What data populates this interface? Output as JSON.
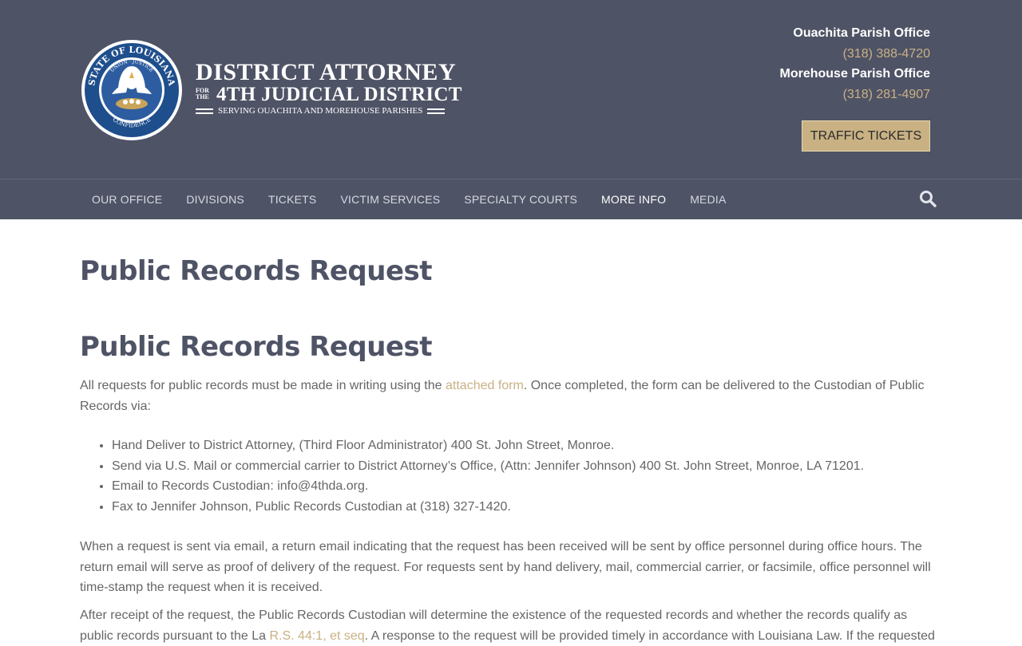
{
  "header": {
    "logo": {
      "seal_text_outer": "STATE OF LOUISIANA",
      "seal_text_inner": "UNION · JUSTICE",
      "seal_text_bottom": "CONFIDENCE",
      "line1": "DISTRICT ATTORNEY",
      "for_the_1": "FOR",
      "for_the_2": "THE",
      "line2": "4TH JUDICIAL DISTRICT",
      "line3": "SERVING OUACHITA AND MOREHOUSE PARISHES"
    },
    "contacts": [
      {
        "office": "Ouachita Parish Office",
        "phone": "(318) 388-4720"
      },
      {
        "office": "Morehouse Parish Office",
        "phone": "(318) 281-4907"
      }
    ],
    "cta_label": "TRAFFIC TICKETS",
    "colors": {
      "header_bg": "#4f5366",
      "accent": "#c9b184"
    }
  },
  "nav": {
    "items": [
      {
        "label": "OUR OFFICE"
      },
      {
        "label": "DIVISIONS"
      },
      {
        "label": "TICKETS"
      },
      {
        "label": "VICTIM SERVICES"
      },
      {
        "label": "SPECIALTY COURTS"
      },
      {
        "label": "MORE INFO"
      },
      {
        "label": "MEDIA"
      }
    ],
    "active": "MORE INFO",
    "search_icon": "search-icon"
  },
  "main": {
    "page_title": "Public Records Request",
    "section_title": "Public Records Request",
    "p1": {
      "before": "All requests for public records must be made in writing using the ",
      "link": "attached form",
      "after": ". Once completed, the form can be delivered to the Custodian of Public Records via:"
    },
    "list": [
      "Hand Deliver to District Attorney, (Third Floor Administrator) 400 St. John Street, Monroe.",
      "Send via U.S. Mail or commercial carrier to District Attorney’s Office, (Attn: Jennifer Johnson) 400 St. John Street, Monroe, LA 71201.",
      "Email to Records Custodian: info@4thda.org.",
      "Fax to Jennifer Johnson, Public Records Custodian at (318) 327-1420."
    ],
    "p2": "When a request is sent via email, a return email indicating that the request has been received will be sent by office personnel during office hours. The return email will serve as proof of delivery of the request. For requests sent by hand delivery, mail, commercial carrier, or facsimile, office personnel will time-stamp the request when it is received.",
    "p3": {
      "before": "After receipt of the request, the Public Records Custodian will determine the existence of the requested records and whether the records qualify as public records pursuant to the La ",
      "link": "R.S. 44:1, et seq",
      "after": ". A response to the request will be provided timely in accordance with Louisiana Law.  If the requested"
    }
  }
}
